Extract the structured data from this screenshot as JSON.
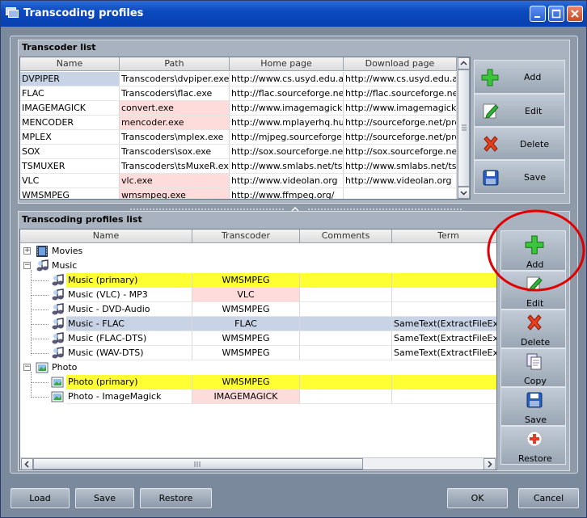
{
  "window": {
    "title": "Transcoding profiles"
  },
  "transcoder_list": {
    "title": "Transcoder list",
    "columns": [
      "Name",
      "Path",
      "Home page",
      "Download page"
    ],
    "rows": [
      {
        "name": "DVPIPER",
        "path": "Transcoders\\dvpiper.exe",
        "home": "http://www.cs.usyd.edu.au,",
        "download": "http://www.cs.usyd.edu.au,",
        "path_missing": false
      },
      {
        "name": "FLAC",
        "path": "Transcoders\\flac.exe",
        "home": "http://flac.sourceforge.net/",
        "download": "http://flac.sourceforge.net/",
        "path_missing": false
      },
      {
        "name": "IMAGEMAGICK",
        "path": "convert.exe",
        "home": "http://www.imagemagick.org",
        "download": "http://www.imagemagick.org",
        "path_missing": true
      },
      {
        "name": "MENCODER",
        "path": "mencoder.exe",
        "home": "http://www.mplayerhq.hu",
        "download": "http://sourceforge.net/proje",
        "path_missing": true
      },
      {
        "name": "MPLEX",
        "path": "Transcoders\\mplex.exe",
        "home": "http://mjpeg.sourceforge.ne",
        "download": "http://sourceforge.net/proje",
        "path_missing": false
      },
      {
        "name": "SOX",
        "path": "Transcoders\\sox.exe",
        "home": "http://sox.sourceforge.net",
        "download": "http://sox.sourceforge.net",
        "path_missing": false
      },
      {
        "name": "TSMUXER",
        "path": "Transcoders\\tsMuxeR.exe",
        "home": "http://www.smlabs.net/tsmu",
        "download": "http://www.smlabs.net/tsmu",
        "path_missing": false
      },
      {
        "name": "VLC",
        "path": "vlc.exe",
        "home": "http://www.videolan.org",
        "download": "http://www.videolan.org",
        "path_missing": true
      },
      {
        "name": "WMSMPEG",
        "path": "wmsmpeg.exe",
        "home": "http://www.ffmpeg.org/",
        "download": "",
        "path_missing": true
      }
    ],
    "buttons": {
      "add": "Add",
      "edit": "Edit",
      "delete": "Delete",
      "save": "Save"
    }
  },
  "profiles_list": {
    "title": "Transcoding profiles list",
    "columns": [
      "Name",
      "Transcoder",
      "Comments",
      "Term"
    ],
    "rows": [
      {
        "name": "Movies",
        "transcoder": "",
        "comments": "",
        "term": ""
      },
      {
        "name": "Music",
        "transcoder": "",
        "comments": "",
        "term": ""
      },
      {
        "name": "Music (primary)",
        "transcoder": "WMSMPEG",
        "comments": "",
        "term": ""
      },
      {
        "name": "Music (VLC) - MP3",
        "transcoder": "VLC",
        "comments": "",
        "term": ""
      },
      {
        "name": "Music - DVD-Audio",
        "transcoder": "WMSMPEG",
        "comments": "",
        "term": ""
      },
      {
        "name": "Music - FLAC",
        "transcoder": "FLAC",
        "comments": "",
        "term": "SameText(ExtractFileExt(m"
      },
      {
        "name": "Music (FLAC-DTS)",
        "transcoder": "WMSMPEG",
        "comments": "",
        "term": "SameText(ExtractFileExt(m"
      },
      {
        "name": "Music (WAV-DTS)",
        "transcoder": "WMSMPEG",
        "comments": "",
        "term": "SameText(ExtractFileExt(m"
      },
      {
        "name": "Photo",
        "transcoder": "",
        "comments": "",
        "term": ""
      },
      {
        "name": "Photo (primary)",
        "transcoder": "WMSMPEG",
        "comments": "",
        "term": ""
      },
      {
        "name": "Photo - ImageMagick",
        "transcoder": "IMAGEMAGICK",
        "comments": "",
        "term": ""
      }
    ],
    "buttons": {
      "add": "Add",
      "edit": "Edit",
      "delete": "Delete",
      "copy": "Copy",
      "save": "Save",
      "restore": "Restore"
    }
  },
  "footer": {
    "load": "Load",
    "save": "Save",
    "restore": "Restore",
    "ok": "OK",
    "cancel": "Cancel"
  },
  "colors": {
    "missing_path": "#ffdcdc",
    "primary_profile": "#ffff33",
    "selection": "#c8d4e6",
    "highlight_ring": "#e00000"
  },
  "icons": {
    "add": "plus-icon",
    "edit": "pencil-edit-icon",
    "delete": "red-x-icon",
    "save": "floppy-disk-icon",
    "copy": "copy-pages-icon",
    "restore": "red-cross-restore-icon",
    "folder_movies": "film-icon",
    "folder_music": "music-note-icon",
    "folder_photo": "picture-icon"
  }
}
